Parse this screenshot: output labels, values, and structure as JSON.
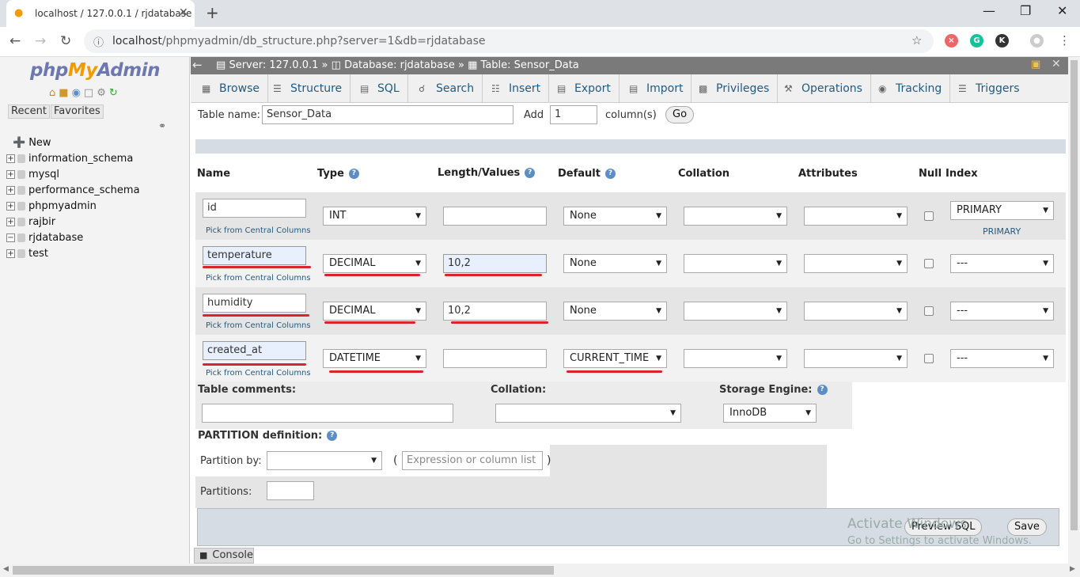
{
  "browser": {
    "tab_title": "localhost / 127.0.0.1 / rjdatabase",
    "url_host": "localhost",
    "url_path": "/phpmyadmin/db_structure.php?server=1&db=rjdatabase"
  },
  "nav": {
    "logo_php": "php",
    "logo_my": "My",
    "logo_admin": "Admin",
    "tabs": [
      "Recent",
      "Favorites"
    ],
    "tree": [
      "New",
      "information_schema",
      "mysql",
      "performance_schema",
      "phpmyadmin",
      "rajbir",
      "rjdatabase",
      "test"
    ]
  },
  "breadcrumb": {
    "server": "Server: 127.0.0.1",
    "database": "Database: rjdatabase",
    "table": "Table: Sensor_Data",
    "sep": "»"
  },
  "tabs": [
    "Browse",
    "Structure",
    "SQL",
    "Search",
    "Insert",
    "Export",
    "Import",
    "Privileges",
    "Operations",
    "Tracking",
    "Triggers"
  ],
  "table_name_row": {
    "label": "Table name:",
    "value": "Sensor_Data",
    "add_label": "Add",
    "add_value": "1",
    "columns_label": "column(s)",
    "go_label": "Go"
  },
  "columns_headers": [
    "Name",
    "Type",
    "Length/Values",
    "Default",
    "Collation",
    "Attributes",
    "Null",
    "Index"
  ],
  "pick_text": "Pick from Central Columns",
  "columns": [
    {
      "name": "id",
      "type": "INT",
      "length": "",
      "default": "None",
      "index": "PRIMARY",
      "index_note": "PRIMARY"
    },
    {
      "name": "temperature",
      "type": "DECIMAL",
      "length": "10,2",
      "default": "None",
      "index": "---",
      "index_note": ""
    },
    {
      "name": "humidity",
      "type": "DECIMAL",
      "length": "10,2",
      "default": "None",
      "index": "---",
      "index_note": ""
    },
    {
      "name": "created_at",
      "type": "DATETIME",
      "length": "",
      "default": "CURRENT_TIME",
      "index": "---",
      "index_note": ""
    }
  ],
  "table_options": {
    "comments_label": "Table comments:",
    "collation_label": "Collation:",
    "engine_label": "Storage Engine:",
    "engine_value": "InnoDB"
  },
  "partition": {
    "title": "PARTITION definition:",
    "by_label": "Partition by:",
    "open_paren": "(",
    "close_paren": ")",
    "expression_placeholder": "Expression or column list",
    "partitions_label": "Partitions:"
  },
  "footer": {
    "preview_label": "Preview SQL",
    "save_label": "Save",
    "watermark_title": "Activate Windows",
    "watermark_sub": "Go to Settings to activate Windows."
  },
  "console_label": "Console"
}
